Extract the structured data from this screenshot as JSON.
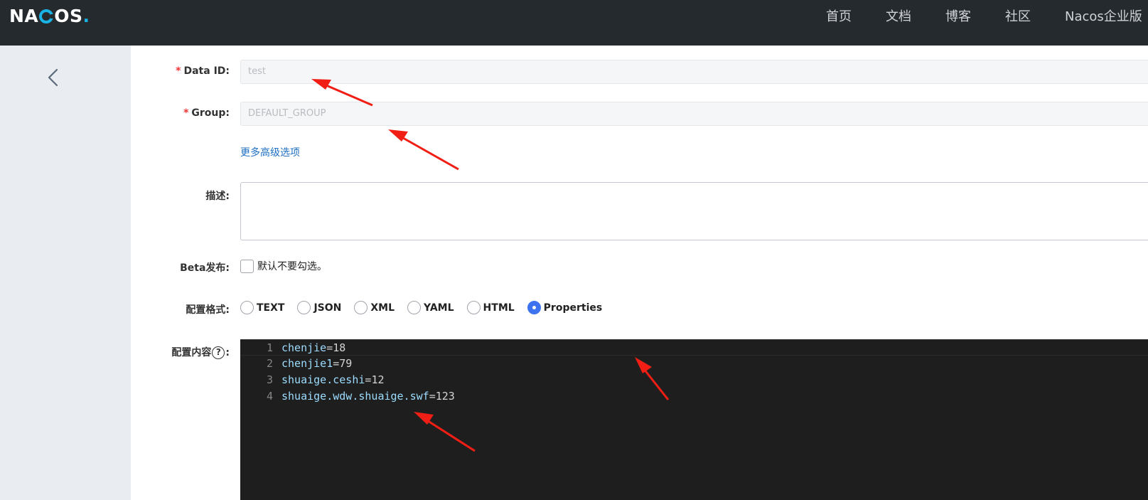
{
  "header": {
    "logo_text_left": "NA",
    "logo_text_right": "OS",
    "logo_dot": ".",
    "nav": [
      "首页",
      "文档",
      "博客",
      "社区",
      "Nacos企业版"
    ]
  },
  "form": {
    "data_id": {
      "required": "*",
      "label": "Data ID:",
      "value": "test"
    },
    "group": {
      "required": "*",
      "label": "Group:",
      "value": "DEFAULT_GROUP"
    },
    "advanced_link": "更多高级选项",
    "description": {
      "label": "描述:",
      "value": ""
    },
    "beta": {
      "label": "Beta发布:",
      "checkbox_label": "默认不要勾选。",
      "checked": false
    },
    "format": {
      "label": "配置格式:",
      "options": [
        "TEXT",
        "JSON",
        "XML",
        "YAML",
        "HTML",
        "Properties"
      ],
      "selected": "Properties"
    },
    "content": {
      "label_prefix": "配置内容",
      "help": "?",
      "label_suffix": ":",
      "lines": [
        {
          "n": "1",
          "key": "chenjie",
          "op": "=",
          "value": "18"
        },
        {
          "n": "2",
          "key": "chenjie1",
          "op": "=",
          "value": "79"
        },
        {
          "n": "3",
          "key": "shuaige.ceshi",
          "op": "=",
          "value": "12"
        },
        {
          "n": "4",
          "key": "shuaige.wdw.shuaige.swf",
          "op": "=",
          "value": "123"
        }
      ]
    }
  },
  "colors": {
    "topbar": "#252a2f",
    "sidebar": "#e9ecf0",
    "accent": "#3e73f0",
    "link": "#1f6fc3",
    "arrow": "#f01e14",
    "editor_bg": "#1e1e1e"
  }
}
